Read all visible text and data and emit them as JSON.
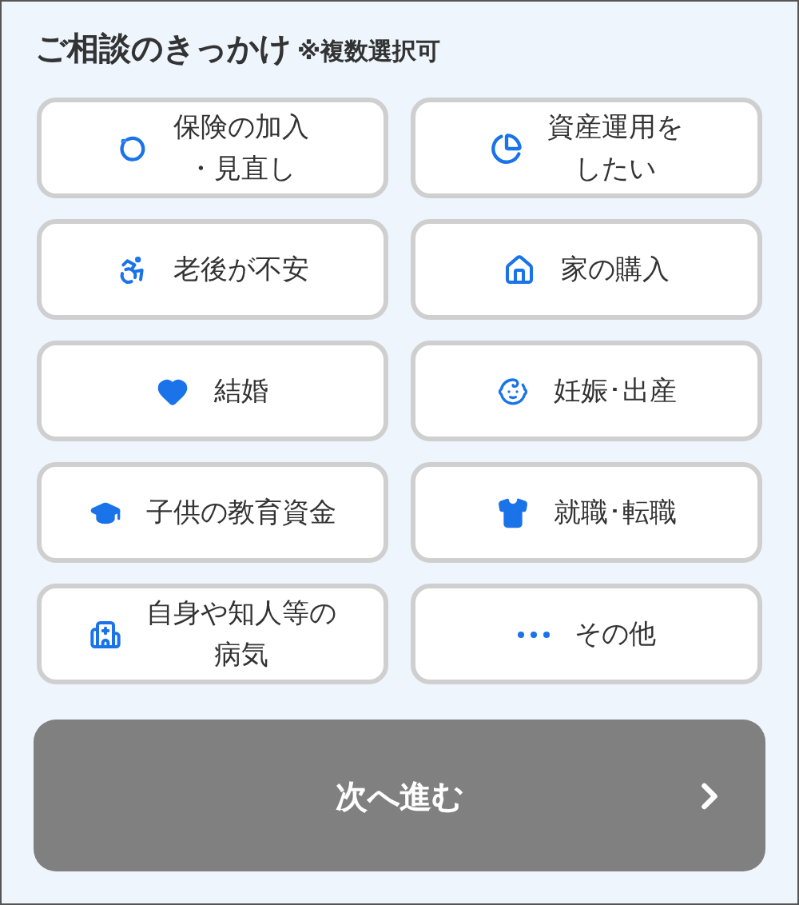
{
  "header": {
    "title": "ご相談のきっかけ",
    "note": "※複数選択可"
  },
  "options": [
    {
      "lines": [
        "保険の加入",
        "・見直し"
      ],
      "selected": false
    },
    {
      "lines": [
        "資産運用を",
        "したい"
      ],
      "selected": false
    },
    {
      "lines": [
        "老後が不安"
      ],
      "selected": false
    },
    {
      "lines": [
        "家の購入"
      ],
      "selected": false
    },
    {
      "lines": [
        "結婚"
      ],
      "selected": false
    },
    {
      "lines": [
        "妊娠･出産"
      ],
      "selected": false
    },
    {
      "lines": [
        "子供の教育資金"
      ],
      "selected": false
    },
    {
      "lines": [
        "就職･転職"
      ],
      "selected": false
    },
    {
      "lines": [
        "自身や知人等の",
        "病気"
      ],
      "selected": false
    },
    {
      "lines": [
        "その他"
      ],
      "selected": false
    }
  ],
  "next_button": {
    "label": "次へ進む",
    "disabled": true
  }
}
